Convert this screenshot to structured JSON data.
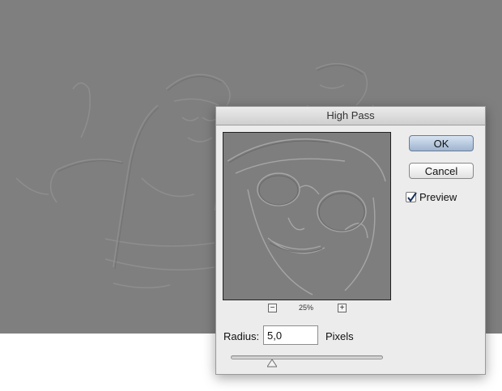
{
  "dialog": {
    "title": "High Pass",
    "ok_label": "OK",
    "cancel_label": "Cancel",
    "preview_label": "Preview",
    "preview_checked": true,
    "zoom_level": "25%",
    "zoom_out_icon": "minus",
    "zoom_in_icon": "plus",
    "radius_label": "Radius:",
    "radius_value": "5,0",
    "radius_units": "Pixels",
    "radius_slider_fraction": 0.27
  },
  "colors": {
    "canvas": "#7f7f7f",
    "dialog_bg": "#ececec",
    "ok_button": "#b3c4db"
  }
}
